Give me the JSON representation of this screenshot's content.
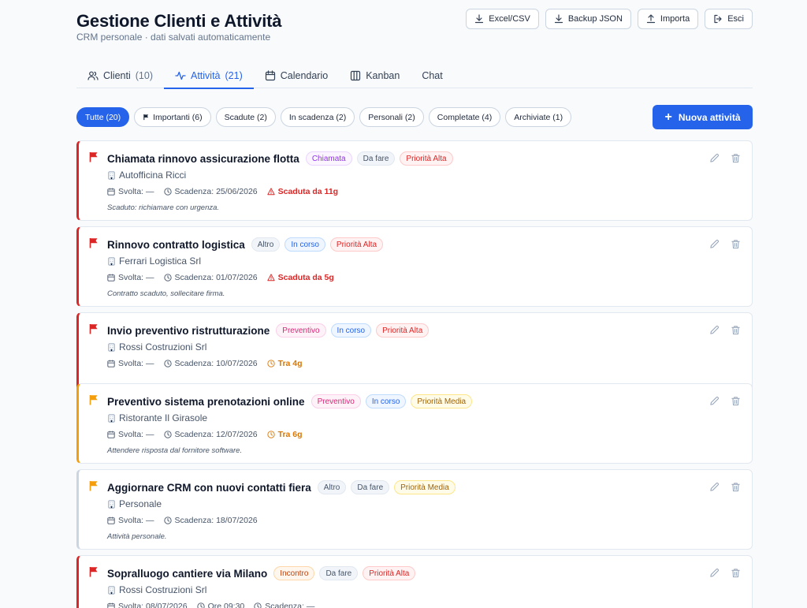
{
  "header": {
    "title": "Gestione Clienti e Attività",
    "subtitle": "CRM personale · dati salvati automaticamente",
    "actions": [
      {
        "label": "Excel/CSV",
        "icon": "download-icon"
      },
      {
        "label": "Backup JSON",
        "icon": "download-icon"
      },
      {
        "label": "Importa",
        "icon": "upload-icon"
      },
      {
        "label": "Esci",
        "icon": "logout-icon"
      }
    ]
  },
  "tabs": [
    {
      "label": "Clienti",
      "count": "(10)",
      "icon": "users-icon"
    },
    {
      "label": "Attività",
      "count": "(21)",
      "icon": "activity-icon",
      "active": true
    },
    {
      "label": "Calendario",
      "count": "",
      "icon": "calendar-icon"
    },
    {
      "label": "Kanban",
      "count": "",
      "icon": "kanban-icon"
    },
    {
      "label": "Chat",
      "count": "",
      "icon": ""
    }
  ],
  "filters": [
    {
      "label": "Tutte (20)",
      "active": true
    },
    {
      "label": "Importanti (6)",
      "icon": "flag-icon"
    },
    {
      "label": "Scadute (2)"
    },
    {
      "label": "In scadenza (2)"
    },
    {
      "label": "Personali (2)"
    },
    {
      "label": "Completate (4)"
    },
    {
      "label": "Archiviate (1)"
    }
  ],
  "new_button": "Nuova attività",
  "colors": {
    "primary": "#2563eb",
    "high": "#dc2626",
    "medium": "#f59e0b",
    "low_border": "#cbd5e1"
  },
  "activities": [
    {
      "title": "Chiamata rinnovo assicurazione flotta",
      "badges": [
        {
          "label": "Chiamata",
          "style": "purple"
        },
        {
          "label": "Da fare",
          "style": "gray"
        },
        {
          "label": "Priorità Alta",
          "style": "red"
        }
      ],
      "client": "Autofficina Ricci",
      "done": "Svolta: —",
      "due": "Scadenza: 25/06/2026",
      "status": "Scaduta da 11g",
      "status_type": "overdue",
      "note": "Scaduto: richiamare con urgenza.",
      "accent": "#dc2626",
      "flag": "#dc2626"
    },
    {
      "title": "Rinnovo contratto logistica",
      "badges": [
        {
          "label": "Altro",
          "style": "gray"
        },
        {
          "label": "In corso",
          "style": "blue"
        },
        {
          "label": "Priorità Alta",
          "style": "red"
        }
      ],
      "client": "Ferrari Logistica Srl",
      "done": "Svolta: —",
      "due": "Scadenza: 01/07/2026",
      "status": "Scaduta da 5g",
      "status_type": "overdue",
      "note": "Contratto scaduto, sollecitare firma.",
      "accent": "#dc2626",
      "flag": "#dc2626"
    },
    {
      "title": "Invio preventivo ristrutturazione",
      "badges": [
        {
          "label": "Preventivo",
          "style": "pink"
        },
        {
          "label": "In corso",
          "style": "blue"
        },
        {
          "label": "Priorità Alta",
          "style": "red"
        }
      ],
      "client": "Rossi Costruzioni Srl",
      "done": "Svolta: —",
      "due": "Scadenza: 10/07/2026",
      "status": "Tra 4g",
      "status_type": "soon",
      "note": "",
      "accent": "#dc2626",
      "flag": "#dc2626"
    },
    {
      "title": "Preventivo sistema prenotazioni online",
      "badges": [
        {
          "label": "Preventivo",
          "style": "pink"
        },
        {
          "label": "In corso",
          "style": "blue"
        },
        {
          "label": "Priorità Media",
          "style": "yellow"
        }
      ],
      "client": "Ristorante Il Girasole",
      "done": "Svolta: —",
      "due": "Scadenza: 12/07/2026",
      "status": "Tra 6g",
      "status_type": "soon",
      "note": "Attendere risposta dal fornitore software.",
      "accent": "#f59e0b",
      "flag": "#f59e0b"
    },
    {
      "title": "Aggiornare CRM con nuovi contatti fiera",
      "badges": [
        {
          "label": "Altro",
          "style": "gray"
        },
        {
          "label": "Da fare",
          "style": "gray"
        },
        {
          "label": "Priorità Media",
          "style": "yellow"
        }
      ],
      "client": "Personale",
      "done": "Svolta: —",
      "due": "Scadenza: 18/07/2026",
      "status": "",
      "status_type": "",
      "note": "Attività personale.",
      "accent": "#cbd5e1",
      "flag": "#f59e0b"
    },
    {
      "title": "Sopralluogo cantiere via Milano",
      "badges": [
        {
          "label": "Incontro",
          "style": "orange"
        },
        {
          "label": "Da fare",
          "style": "gray"
        },
        {
          "label": "Priorità Alta",
          "style": "red"
        }
      ],
      "client": "Rossi Costruzioni Srl",
      "done": "Svolta: 08/07/2026",
      "time": "Ore 09:30",
      "due": "Scadenza: —",
      "status": "",
      "status_type": "",
      "note": "",
      "accent": "#dc2626",
      "flag": "#dc2626"
    }
  ]
}
